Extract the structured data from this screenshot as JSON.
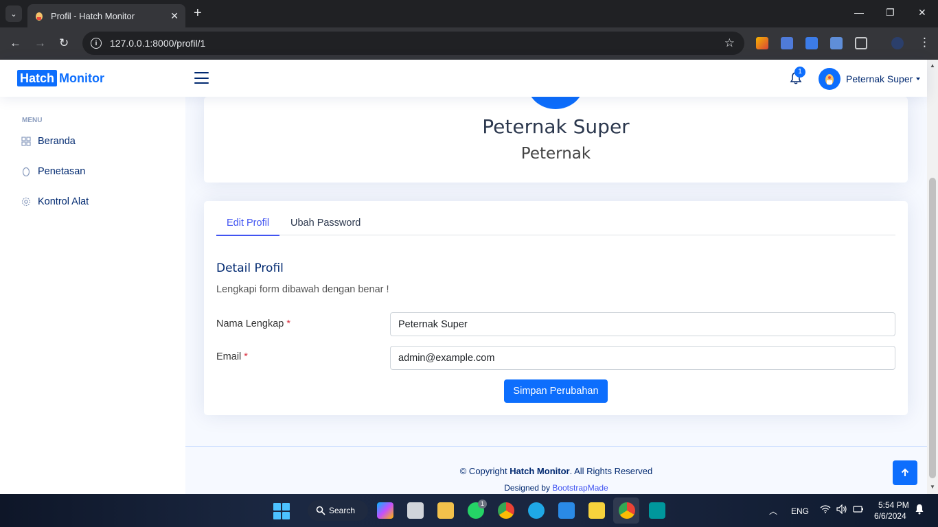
{
  "browser": {
    "tab_title": "Profil - Hatch Monitor",
    "url": "127.0.0.1:8000/profil/1"
  },
  "header": {
    "logo_part1": "Hatch",
    "logo_part2": "Monitor",
    "notification_count": "1",
    "user_name": "Peternak Super"
  },
  "sidebar": {
    "heading": "MENU",
    "items": [
      {
        "label": "Beranda",
        "icon": "grid-icon"
      },
      {
        "label": "Penetasan",
        "icon": "egg-icon"
      },
      {
        "label": "Kontrol Alat",
        "icon": "gear-icon"
      }
    ]
  },
  "profile_card": {
    "name": "Peternak Super",
    "role": "Peternak"
  },
  "form_card": {
    "tabs": [
      {
        "label": "Edit Profil",
        "active": true
      },
      {
        "label": "Ubah Password",
        "active": false
      }
    ],
    "section_title": "Detail Profil",
    "section_desc": "Lengkapi form dibawah dengan benar !",
    "fields": [
      {
        "label": "Nama Lengkap",
        "required_mark": "*",
        "value": "Peternak Super"
      },
      {
        "label": "Email",
        "required_mark": "*",
        "value": "admin@example.com"
      }
    ],
    "save_label": "Simpan Perubahan"
  },
  "footer": {
    "copyright_prefix": "© Copyright",
    "brand": "Hatch Monitor",
    "copyright_suffix": ". All Rights Reserved",
    "designed_by": "Designed by",
    "designer": "BootstrapMade"
  },
  "taskbar": {
    "search_label": "Search",
    "language": "ENG",
    "time": "5:54 PM",
    "date": "6/6/2024",
    "whatsapp_badge": "1"
  },
  "colors": {
    "primary": "#0d6efd",
    "nav_text": "#012970",
    "tab_active": "#4154f1",
    "required": "#dc3545"
  }
}
